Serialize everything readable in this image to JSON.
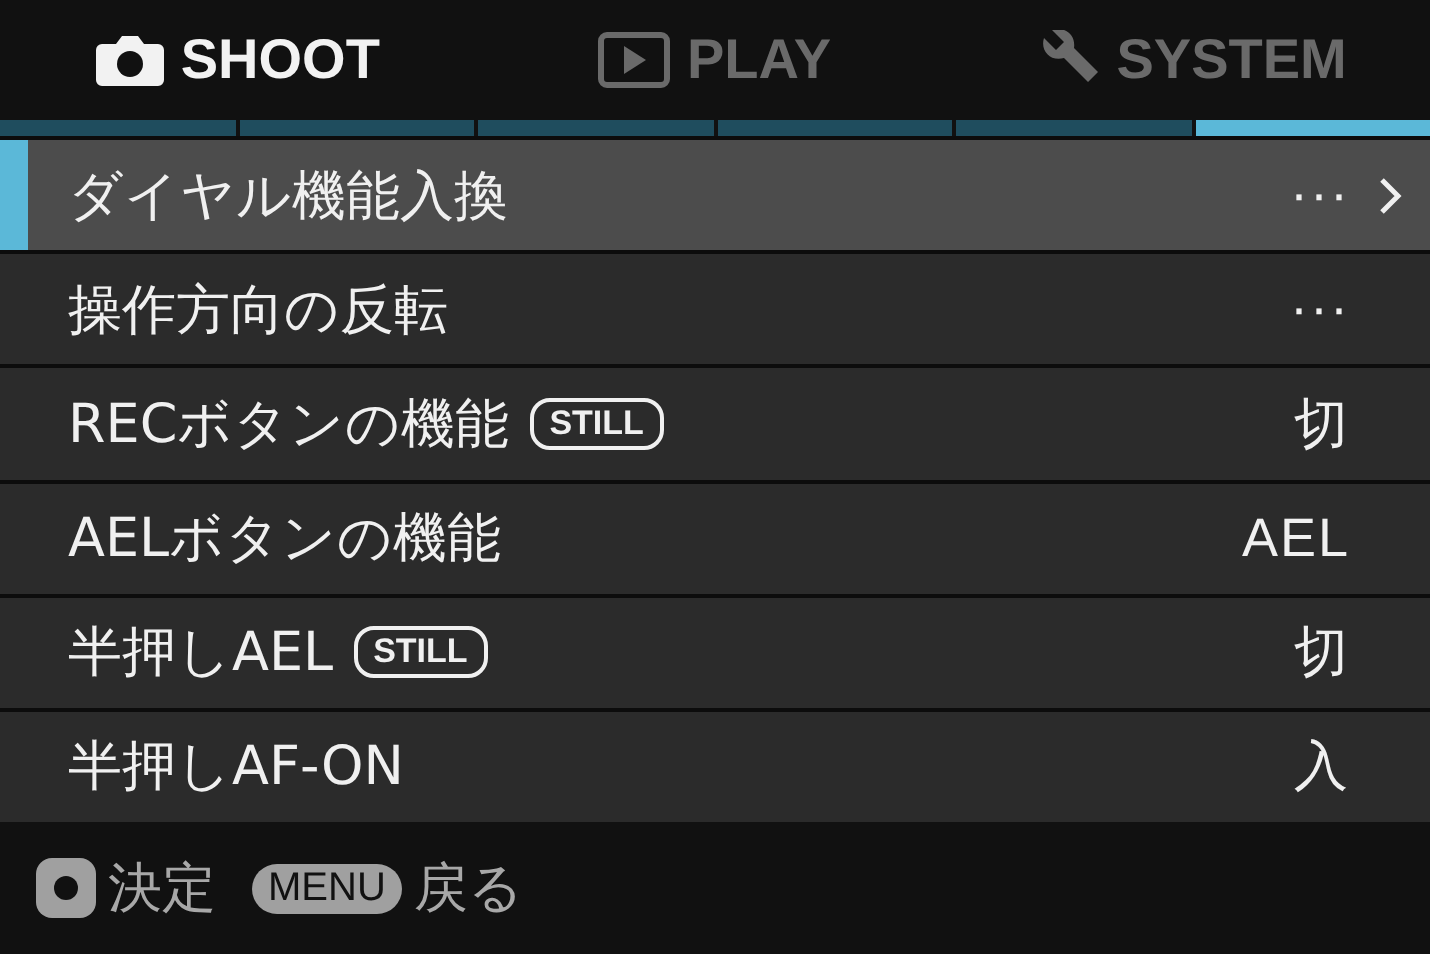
{
  "tabs": [
    {
      "kind": "camera",
      "label": "SHOOT",
      "selected": true
    },
    {
      "kind": "play",
      "label": "PLAY",
      "selected": false
    },
    {
      "kind": "wrench",
      "label": "SYSTEM",
      "selected": false
    }
  ],
  "pages": [
    {
      "selected": false
    },
    {
      "selected": false
    },
    {
      "selected": false
    },
    {
      "selected": false
    },
    {
      "selected": false
    },
    {
      "selected": true
    }
  ],
  "rows": [
    {
      "label": "ダイヤル機能入換",
      "value": "···",
      "submenu": true,
      "selected": true
    },
    {
      "label": "操作方向の反転",
      "value": "···",
      "submenu": false,
      "selected": false
    },
    {
      "label": "RECボタンの機能",
      "badge": "STILL",
      "value": "切",
      "submenu": false,
      "selected": false
    },
    {
      "label": "AELボタンの機能",
      "value": "AEL",
      "submenu": false,
      "selected": false
    },
    {
      "label": "半押しAEL",
      "badge": "STILL",
      "value": "切",
      "submenu": false,
      "selected": false
    },
    {
      "label": "半押しAF-ON",
      "value": "入",
      "submenu": false,
      "selected": false
    }
  ],
  "footer": [
    {
      "kind": "ok",
      "label": "決定"
    },
    {
      "kind": "menu",
      "key": "MENU",
      "label": "戻る"
    }
  ]
}
